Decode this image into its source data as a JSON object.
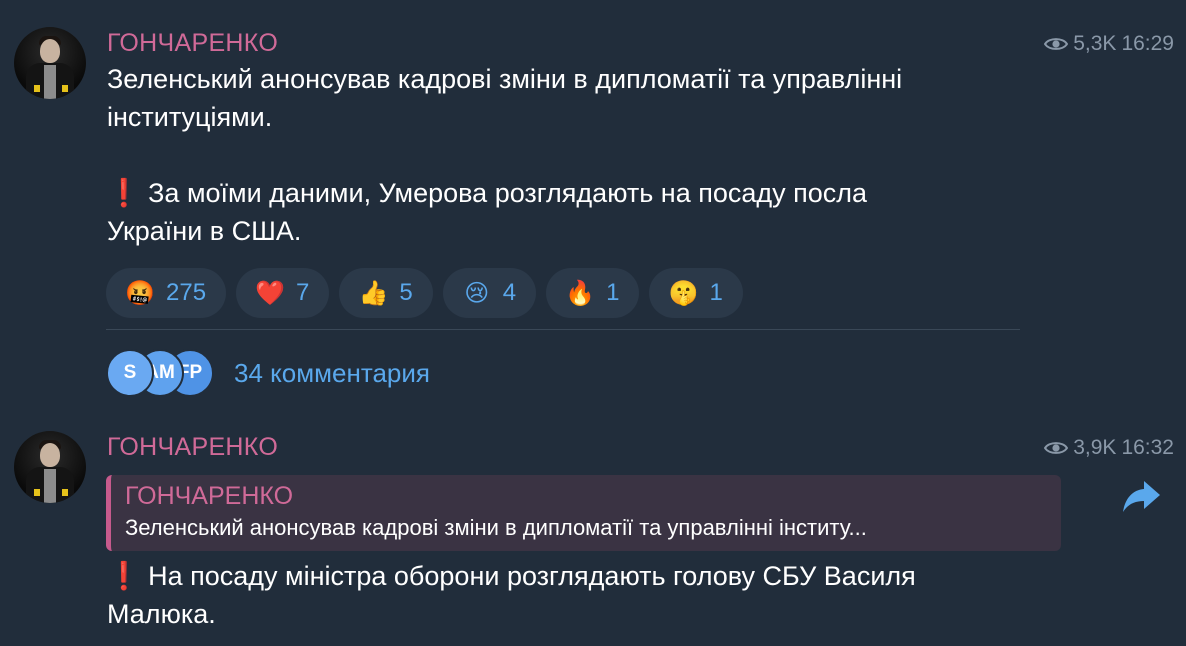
{
  "post1": {
    "channel_name": "ГОНЧАРЕНКО",
    "views": "5,3K",
    "time": "16:29",
    "text": "Зеленський анонсував кадрові зміни в дипломатії та управлінні\nінституціями.\n\n❗ За моїми даними, Умерова розглядають на посаду посла\nУкраїни в США.",
    "reactions": [
      {
        "icon": "swearing-face-icon",
        "emoji": "🤬",
        "count": "275"
      },
      {
        "icon": "red-heart-icon",
        "emoji": "❤️",
        "count": "7"
      },
      {
        "icon": "thumbs-up-icon",
        "emoji": "👍",
        "count": "5"
      },
      {
        "icon": "crying-face-icon",
        "emoji": "😢",
        "count": "4"
      },
      {
        "icon": "fire-icon",
        "emoji": "🔥",
        "count": "1"
      },
      {
        "icon": "shushing-face-icon",
        "emoji": "🤫",
        "count": "1"
      }
    ],
    "comments": {
      "avatars": [
        {
          "initials": "S",
          "color": "#6aa9f2"
        },
        {
          "initials": "AM",
          "color": "#5fa2ee"
        },
        {
          "initials": "FP",
          "color": "#4f93e6"
        }
      ],
      "label": "34 комментария"
    }
  },
  "post2": {
    "channel_name": "ГОНЧАРЕНКО",
    "views": "3,9K",
    "time": "16:32",
    "reply": {
      "name": "ГОНЧАРЕНКО",
      "text": "Зеленський анонсував кадрові зміни в дипломатії та управлінні інститу..."
    },
    "text": "❗ На посаду міністра оборони розглядають голову СБУ Василя\nМалюка."
  },
  "colors": {
    "background": "#212d3b",
    "channel_name": "#d06a98",
    "link": "#5aa8ec",
    "meta": "#8a98a8",
    "reaction_bg": "#2b3949",
    "share_icon": "#5aa8ec"
  },
  "icons": {
    "views": "eye-icon",
    "share": "share-arrow-icon"
  }
}
